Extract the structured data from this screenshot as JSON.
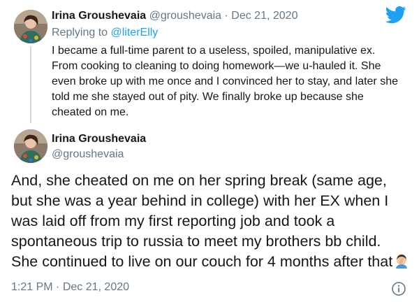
{
  "reply_tweet": {
    "display_name": "Irina Groushevaia",
    "handle": "@groushevaia",
    "separator": "·",
    "date": "Dec 21, 2020",
    "replying_prefix": "Replying to",
    "replying_to": "@literElly",
    "body": "I became a full-time parent to a useless, spoiled, manipulative ex. From cooking to cleaning to doing homework—we u-hauled it. She even broke up with me once and I convinced her to stay, and later she told me she stayed out of pity. We finally broke up because she cheated on me."
  },
  "main_tweet": {
    "display_name": "Irina Groushevaia",
    "handle": "@groushevaia",
    "body": "And, she cheated on me on her spring break (same age, but she was a year behind in college) with her EX when I was laid off from my first reporting job and took a spontaneous trip to russia to meet my brothers bb child. She continued to live on our couch for 4 months after that",
    "emoji": "man-facepalming-emoji",
    "time": "1:21 PM",
    "separator": "·",
    "date": "Dec 21, 2020"
  },
  "icons": {
    "logo": "twitter-bird-icon",
    "info": "info-icon"
  },
  "colors": {
    "accent": "#1da1f2",
    "muted": "#657786",
    "text": "#14171a",
    "thread_line": "#cfd9de"
  }
}
